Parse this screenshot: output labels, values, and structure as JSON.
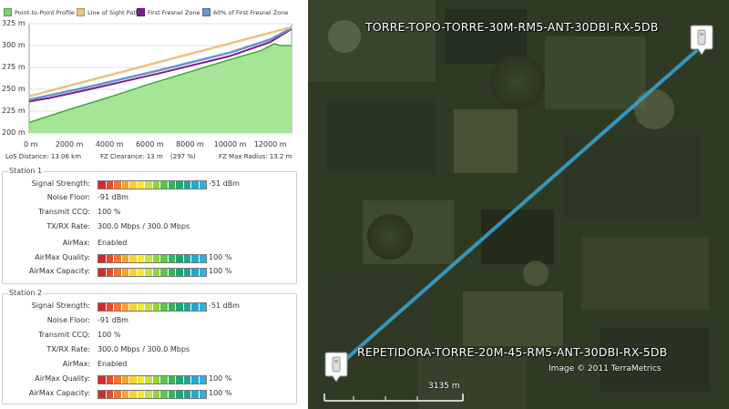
{
  "legend": {
    "point_to_point": "Point-to-Point Profile",
    "line_of_sight": "Line of Sight Path",
    "first_fresnel": "First Fresnel Zone",
    "fresnel_60": "60% of First Fresnel Zone",
    "colors": {
      "terrain": "#7cd16b",
      "los": "#e6c483",
      "fresnel": "#7a1f8a",
      "fresnel60": "#6a93c8"
    }
  },
  "chart_data": {
    "type": "area",
    "x_unit": "m",
    "x_ticks": [
      "0 m",
      "2000 m",
      "4000 m",
      "6000 m",
      "8000 m",
      "10000 m",
      "12000 m"
    ],
    "y_ticks": [
      "200 m",
      "225 m",
      "250 m",
      "275 m",
      "300 m",
      "325 m"
    ],
    "xlim": [
      0,
      13060
    ],
    "ylim": [
      200,
      325
    ],
    "series": [
      {
        "name": "Point-to-Point Profile",
        "x": [
          0,
          2000,
          4000,
          6000,
          8000,
          10000,
          11500,
          12200,
          12500,
          13060
        ],
        "y": [
          212,
          227,
          241,
          256,
          270,
          284,
          294,
          302,
          300,
          300
        ]
      },
      {
        "name": "Line of Sight Path",
        "x": [
          0,
          13060
        ],
        "y": [
          242,
          321
        ]
      },
      {
        "name": "First Fresnel Zone",
        "x": [
          0,
          1000,
          3000,
          6530,
          10000,
          12000,
          13060
        ],
        "y": [
          236,
          240,
          250,
          268.5,
          288,
          304,
          319
        ]
      },
      {
        "name": "60% of First Fresnel Zone",
        "x": [
          0,
          1000,
          3000,
          6530,
          10000,
          12000,
          13060
        ],
        "y": [
          238,
          243,
          253,
          272,
          292,
          307,
          320
        ]
      }
    ]
  },
  "info": {
    "los_distance": "LoS Distance: 13.06 km",
    "fz_clearance": "FZ Clearance: 13 m",
    "fz_clearance_pct": "(297 %)",
    "fz_max_radius": "FZ Max Radius: 13.2 m"
  },
  "stations": [
    {
      "title": "Station 1",
      "signal_label": "Signal Strength:",
      "signal_value": "-51 dBm",
      "noise_label": "Noise Floor:",
      "noise_value": "-91 dBm",
      "ccq_label": "Transmit CCQ:",
      "ccq_value": "100 %",
      "rate_label": "TX/RX Rate:",
      "rate_value": "300.0 Mbps / 300.0 Mbps",
      "airmax_label": "AirMax:",
      "airmax_value": "Enabled",
      "quality_label": "AirMax Quality:",
      "quality_value": "100 %",
      "capacity_label": "AirMax Capacity:",
      "capacity_value": "100 %"
    },
    {
      "title": "Station 2",
      "signal_label": "Signal Strength:",
      "signal_value": "-51 dBm",
      "noise_label": "Noise Floor:",
      "noise_value": "-91 dBm",
      "ccq_label": "Transmit CCQ:",
      "ccq_value": "100 %",
      "rate_label": "TX/RX Rate:",
      "rate_value": "300.0 Mbps / 300.0 Mbps",
      "airmax_label": "AirMax:",
      "airmax_value": "Enabled",
      "quality_label": "AirMax Quality:",
      "quality_value": "100 %",
      "capacity_label": "AirMax Capacity:",
      "capacity_value": "100 %"
    }
  ],
  "meter_colors": [
    "#d9262b",
    "#e84a2b",
    "#f0772b",
    "#f7a32c",
    "#fbd02f",
    "#f2e931",
    "#c9e235",
    "#93d43d",
    "#5fc649",
    "#34b55a",
    "#21a86f",
    "#1fa39a",
    "#27a8c7",
    "#2fb0e2"
  ],
  "map": {
    "site_top": "TORRE-TOPO-TORRE-30M-RM5-ANT-30DBI-RX-5DB",
    "site_bottom": "REPETIDORA-TORRE-20M-45-RM5-ANT-30DBI-RX-5DB",
    "credit": "Image © 2011 TerraMetrics",
    "scale": "3135 m",
    "link_color": "#3aa6d4"
  }
}
